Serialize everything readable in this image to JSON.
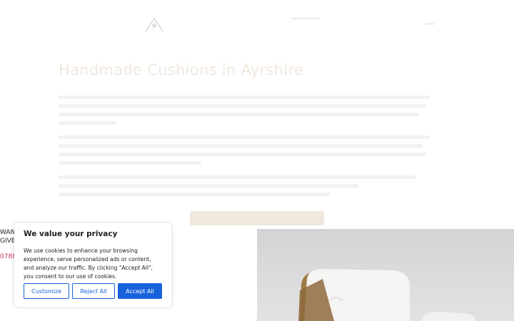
{
  "page": {
    "heading": "Handmade Cushions in Ayrshire",
    "left_text_line1": "WANT",
    "left_text_line2": "GIVE",
    "phone_partial": "0788"
  },
  "cookie_banner": {
    "title": "We value your privacy",
    "body": "We use cookies to enhance your browsing experience, serve personalized ads or content, and analyze our traffic. By clicking \"Accept All\", you consent to our use of cookies.",
    "customize_label": "Customize",
    "reject_label": "Reject All",
    "accept_label": "Accept All"
  },
  "colors": {
    "accent_blue": "#1863dc",
    "brand_gold": "#b1874f",
    "phone_red": "#c23a52"
  }
}
